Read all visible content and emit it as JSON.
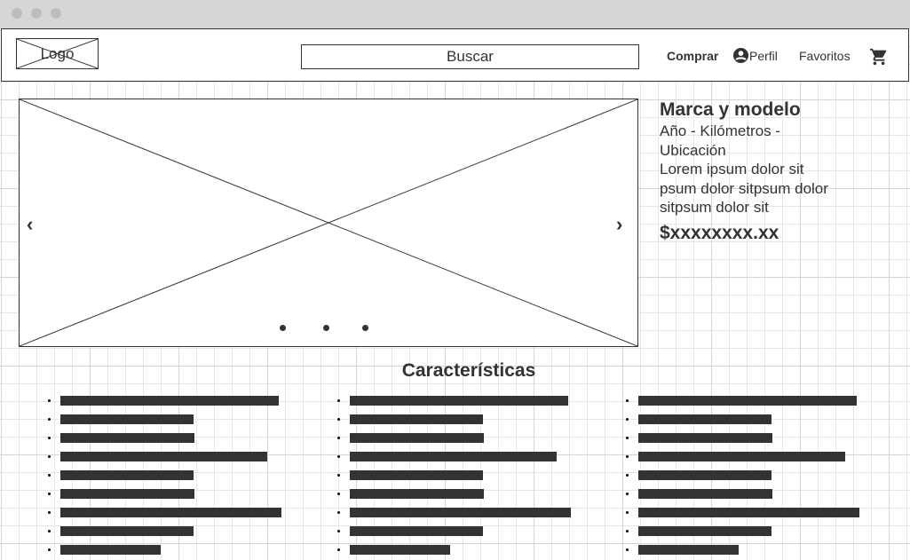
{
  "header": {
    "logo": "Logo",
    "search_placeholder": "Buscar",
    "nav": {
      "comprar": "Comprar",
      "perfil": "Perfil",
      "favoritos": "Favoritos"
    },
    "icons": [
      "user-circle-icon",
      "cart-icon"
    ]
  },
  "product": {
    "title": "Marca y modelo",
    "subtitle": "Año - Kilómetros - Ubicación",
    "description": "Lorem ipsum dolor sit psum dolor sitpsum dolor sitpsum dolor sit",
    "price": "$xxxxxxxx.xx"
  },
  "carousel": {
    "slides": 3,
    "active": 0
  },
  "features": {
    "title": "Características",
    "columns": 3,
    "items_per_column": 9
  }
}
